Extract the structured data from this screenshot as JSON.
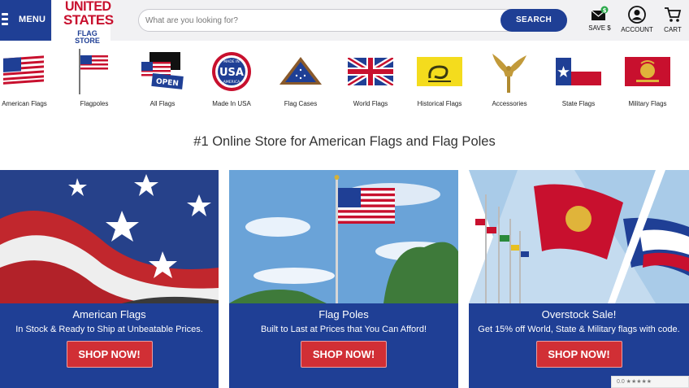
{
  "header": {
    "menu_label": "MENU",
    "logo": {
      "line1": "UNITED",
      "line2": "STATES",
      "line3": "FLAG STORE"
    },
    "search": {
      "placeholder": "What are you looking for?",
      "button_label": "SEARCH"
    },
    "links": [
      {
        "label": "SAVE $",
        "icon": "envelope-dollar-icon"
      },
      {
        "label": "ACCOUNT",
        "icon": "user-icon"
      },
      {
        "label": "CART",
        "icon": "cart-icon"
      }
    ]
  },
  "categories": [
    {
      "label": "American Flags",
      "icon": "american-flag-icon"
    },
    {
      "label": "Flagpoles",
      "icon": "flagpole-icon"
    },
    {
      "label": "All Flags",
      "icon": "all-flags-icon"
    },
    {
      "label": "Made In USA",
      "icon": "made-in-usa-icon"
    },
    {
      "label": "Flag Cases",
      "icon": "flag-case-icon"
    },
    {
      "label": "World Flags",
      "icon": "union-jack-icon"
    },
    {
      "label": "Historical Flags",
      "icon": "gadsden-flag-icon"
    },
    {
      "label": "Accessories",
      "icon": "eagle-topper-icon"
    },
    {
      "label": "State Flags",
      "icon": "texas-flag-icon"
    },
    {
      "label": "Military Flags",
      "icon": "marine-flag-icon"
    }
  ],
  "tagline": "#1 Online Store for American Flags and Flag Poles",
  "promos": [
    {
      "title": "American Flags",
      "desc": "In Stock & Ready to Ship at Unbeatable Prices.",
      "button": "SHOP NOW!"
    },
    {
      "title": "Flag Poles",
      "desc": "Built to Last at Prices that You Can Afford!",
      "button": "SHOP NOW!"
    },
    {
      "title": "Overstock Sale!",
      "desc": "Get 15% off World, State & Military flags with code.",
      "button": "SHOP NOW!"
    }
  ],
  "rating_widget": "0.0 ★★★★★",
  "colors": {
    "brand_blue": "#1f3f95",
    "brand_red": "#c8102e",
    "button_red": "#d12f35"
  }
}
